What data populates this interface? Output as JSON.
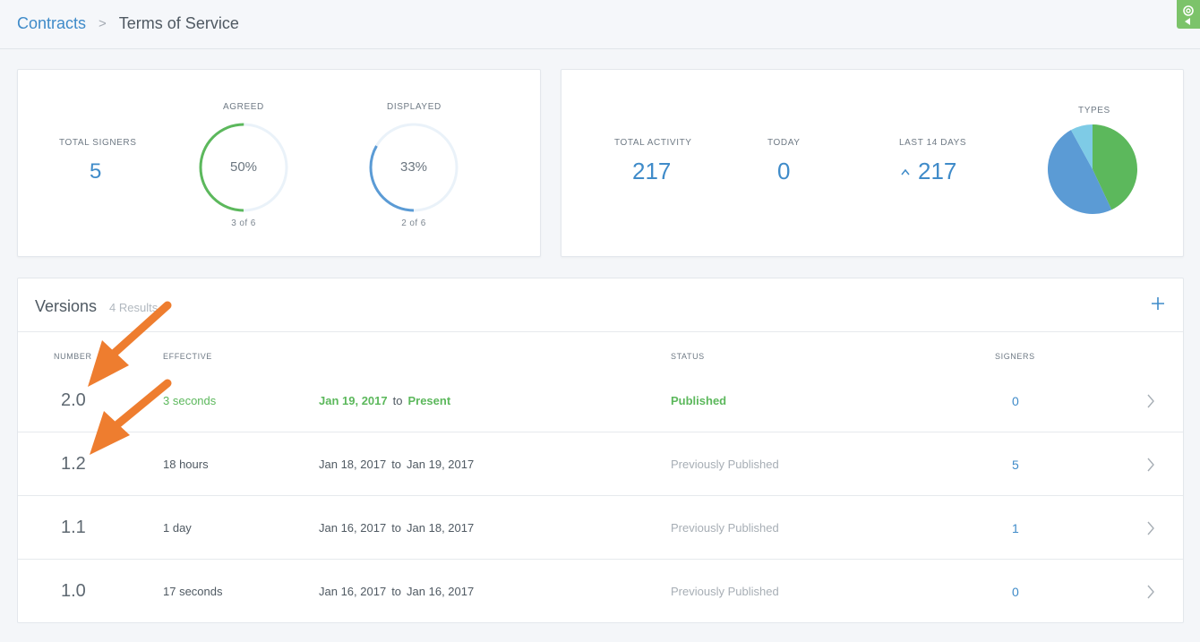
{
  "breadcrumb": {
    "parent": "Contracts",
    "separator": ">",
    "current": "Terms of Service"
  },
  "colors": {
    "accent": "#3f8bc9",
    "success": "#5cb85c",
    "annotation": "#ee7d2f",
    "pie_green": "#5cb85c",
    "pie_blue": "#5b9bd5",
    "pie_cyan": "#7ecbe6"
  },
  "summary": {
    "total_signers": {
      "label": "TOTAL SIGNERS",
      "value": "5"
    },
    "agreed": {
      "label": "AGREED",
      "percent_text": "50%",
      "sub": "3 of 6",
      "fraction": 0.5
    },
    "displayed": {
      "label": "DISPLAYED",
      "percent_text": "33%",
      "sub": "2 of 6",
      "fraction": 0.333
    }
  },
  "activity": {
    "total": {
      "label": "TOTAL ACTIVITY",
      "value": "217"
    },
    "today": {
      "label": "TODAY",
      "value": "0"
    },
    "last14": {
      "label": "LAST 14 DAYS",
      "value": "217",
      "trend_icon": "chevron-up-icon"
    },
    "types": {
      "label": "TYPES",
      "slices": [
        0.43,
        0.49,
        0.08
      ]
    }
  },
  "versions": {
    "title": "Versions",
    "count": "4 Results",
    "add_icon": "plus-icon",
    "columns": {
      "number": "NUMBER",
      "effective": "EFFECTIVE",
      "status": "STATUS",
      "signers": "SIGNERS"
    },
    "rows": [
      {
        "number": "2.0",
        "age": "3 seconds",
        "from": "Jan 19, 2017",
        "to_word": "to",
        "until": "Present",
        "status": "Published",
        "signers": "0",
        "current": true
      },
      {
        "number": "1.2",
        "age": "18 hours",
        "from": "Jan 18, 2017",
        "to_word": "to",
        "until": "Jan 19, 2017",
        "status": "Previously Published",
        "signers": "5",
        "current": false
      },
      {
        "number": "1.1",
        "age": "1 day",
        "from": "Jan 16, 2017",
        "to_word": "to",
        "until": "Jan 18, 2017",
        "status": "Previously Published",
        "signers": "1",
        "current": false
      },
      {
        "number": "1.0",
        "age": "17 seconds",
        "from": "Jan 16, 2017",
        "to_word": "to",
        "until": "Jan 16, 2017",
        "status": "Previously Published",
        "signers": "0",
        "current": false
      }
    ]
  }
}
